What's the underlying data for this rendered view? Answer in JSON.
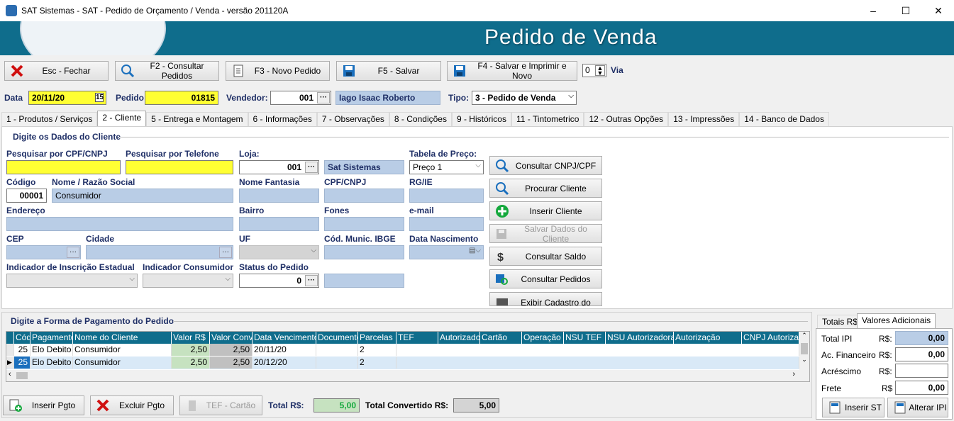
{
  "window": {
    "title": "SAT Sistemas - SAT - Pedido de Orçamento / Venda - versão 201120A",
    "minimize": "–",
    "maximize": "☐",
    "close": "✕"
  },
  "banner": {
    "title": "Pedido de Venda"
  },
  "toolbar": {
    "close_label": "Esc - Fechar",
    "consult_label": "F2 - Consultar Pedidos",
    "new_label": "F3 - Novo Pedido",
    "save_label": "F5 - Salvar",
    "save_print_label": "F4 - Salvar e Imprimir e Novo",
    "vias_value": "0",
    "vias_label": "Via"
  },
  "header": {
    "data_label": "Data",
    "data_value": "20/11/20",
    "pedido_label": "Pedido",
    "pedido_value": "01815",
    "vendedor_label": "Vendedor:",
    "vendedor_code": "001",
    "vendedor_name": "Iago Isaac Roberto",
    "tipo_label": "Tipo:",
    "tipo_value": "3 - Pedido de Venda"
  },
  "tabs": [
    "1 - Produtos / Serviços",
    "2 - Cliente",
    "5 - Entrega e Montagem",
    "6 - Informações",
    "7 - Observações",
    "8 - Condições",
    "9 - Históricos",
    "11 - Tintometrico",
    "12 - Outras Opções",
    "13 - Impressões",
    "14 - Banco de Dados"
  ],
  "cliente": {
    "section_title": "Digite os Dados do Cliente",
    "cpf_search_label": "Pesquisar por CPF/CNPJ",
    "cpf_search_value": "",
    "phone_search_label": "Pesquisar por Telefone",
    "phone_search_value": "",
    "loja_label": "Loja:",
    "loja_code": "001",
    "loja_name": "Sat Sistemas",
    "tabela_label": "Tabela de Preço:",
    "tabela_value": "Preço 1",
    "codigo_label": "Código",
    "codigo_value": "00001",
    "nome_label": "Nome / Razão Social",
    "nome_value": "Consumidor",
    "fantasia_label": "Nome Fantasia",
    "cpfcnpj_label": "CPF/CNPJ",
    "rgie_label": "RG/IE",
    "endereco_label": "Endereço",
    "bairro_label": "Bairro",
    "fones_label": "Fones",
    "email_label": "e-mail",
    "cep_label": "CEP",
    "cidade_label": "Cidade",
    "uf_label": "UF",
    "ibge_label": "Cód. Munic. IBGE",
    "nascimento_label": "Data Nascimento",
    "ie_indicator_label": "Indicador de Inscrição Estadual",
    "consumer_indicator_label": "Indicador Consumidor",
    "status_label": "Status do Pedido",
    "status_value": "0",
    "actions": {
      "consult_cnpj": "Consultar CNPJ/CPF",
      "find_client": "Procurar Cliente",
      "insert_client": "Inserir Cliente",
      "save_client": "Salvar Dados do Cliente",
      "consult_balance": "Consultar Saldo",
      "consult_orders": "Consultar Pedidos",
      "show_client": "Exibir Cadastro do Cliente"
    }
  },
  "payment": {
    "section_title": "Digite a Forma de Pagamento do Pedido",
    "columns": [
      "Cód",
      "Pagamento",
      "Nome do Cliente",
      "Valor R$",
      "Valor Conv",
      "Data Vencimento",
      "Documento",
      "Parcelas",
      "TEF",
      "Autorizador",
      "Cartão",
      "Operação",
      "NSU TEF",
      "NSU Autorizadora",
      "Autorização",
      "CNPJ Autorizado"
    ],
    "rows": [
      [
        "25",
        "Elo Debito",
        "Consumidor",
        "2,50",
        "2,50",
        "20/11/20",
        "",
        "2"
      ],
      [
        "25",
        "Elo Debito",
        "Consumidor",
        "2,50",
        "2,50",
        "20/12/20",
        "",
        "2"
      ]
    ],
    "insert_label": "Inserir Pgto",
    "delete_label": "Excluir Pgto",
    "tef_label": "TEF - Cartão",
    "total_label": "Total R$:",
    "total_value": "5,00",
    "total_conv_label": "Total Convertido R$:",
    "total_conv_value": "5,00"
  },
  "totals": {
    "tab1": "Totais R$",
    "tab2": "Valores Adicionais",
    "total_ipi_label": "Total IPI",
    "total_ipi_cur": "R$:",
    "total_ipi_value": "0,00",
    "ac_fin_label": "Ac. Financeiro",
    "ac_fin_cur": "R$:",
    "ac_fin_value": "0,00",
    "acrescimo_label": "Acréscimo",
    "acrescimo_cur": "R$:",
    "acrescimo_value": "",
    "frete_label": "Frete",
    "frete_cur": "R$",
    "frete_value": "0,00",
    "insert_st": "Inserir ST",
    "alter_ipi": "Alterar IPI"
  }
}
